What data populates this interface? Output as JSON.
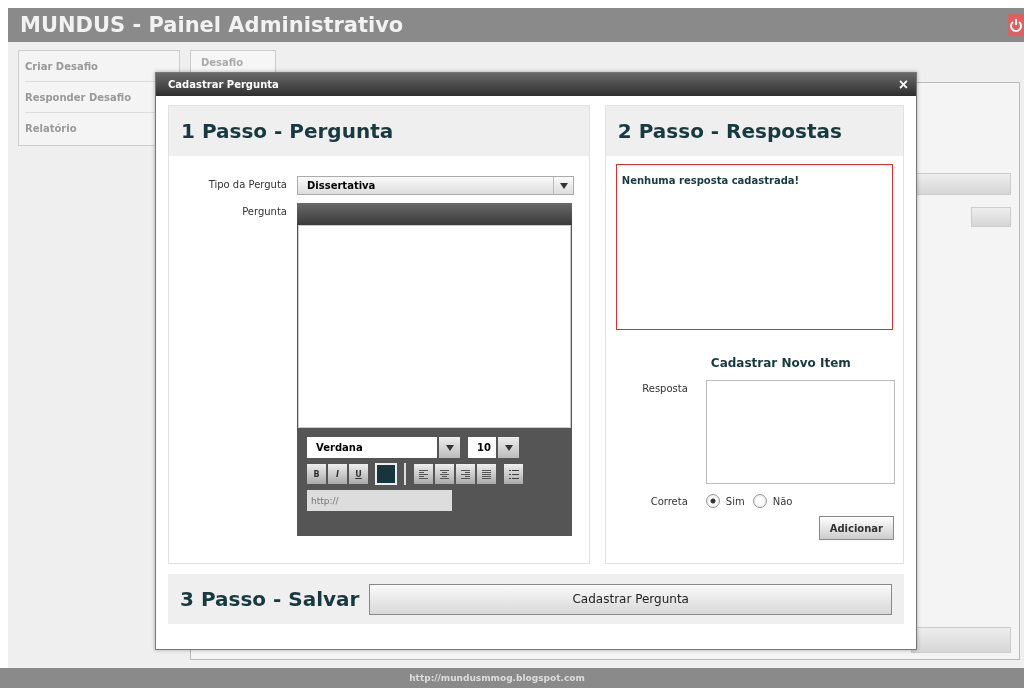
{
  "header": {
    "title": "MUNDUS - Painel Administrativo"
  },
  "sidebar": {
    "items": [
      {
        "label": "Criar Desafio",
        "selected": false
      },
      {
        "label": "Responder Desafio",
        "selected": false
      },
      {
        "label": "Relatório",
        "selected": false
      }
    ]
  },
  "tabs": [
    {
      "label": "Desafio",
      "selected": true
    }
  ],
  "footer": {
    "url": "http://mundusmmog.blogspot.com"
  },
  "dialog": {
    "title": "Cadastrar Pergunta",
    "close": "×",
    "step1": {
      "heading": "1 Passo - Pergunta",
      "type_label": "Tipo da Perguta",
      "type_value": "Dissertativa",
      "question_label": "Pergunta",
      "editor": {
        "font": "Verdana",
        "size": "10",
        "format_buttons": [
          "B",
          "I",
          "U"
        ],
        "link_placeholder": "http://"
      }
    },
    "step2": {
      "heading": "2 Passo - Respostas",
      "empty_message": "Nenhuma resposta cadastrada!",
      "new_item_heading": "Cadastrar Novo Item",
      "answer_label": "Resposta",
      "correct_label": "Correta",
      "correct_options": [
        {
          "label": "Sim",
          "selected": true
        },
        {
          "label": "Não",
          "selected": false
        }
      ],
      "add_button": "Adicionar"
    },
    "step3": {
      "heading": "3 Passo - Salvar",
      "save_button": "Cadastrar Pergunta"
    }
  }
}
